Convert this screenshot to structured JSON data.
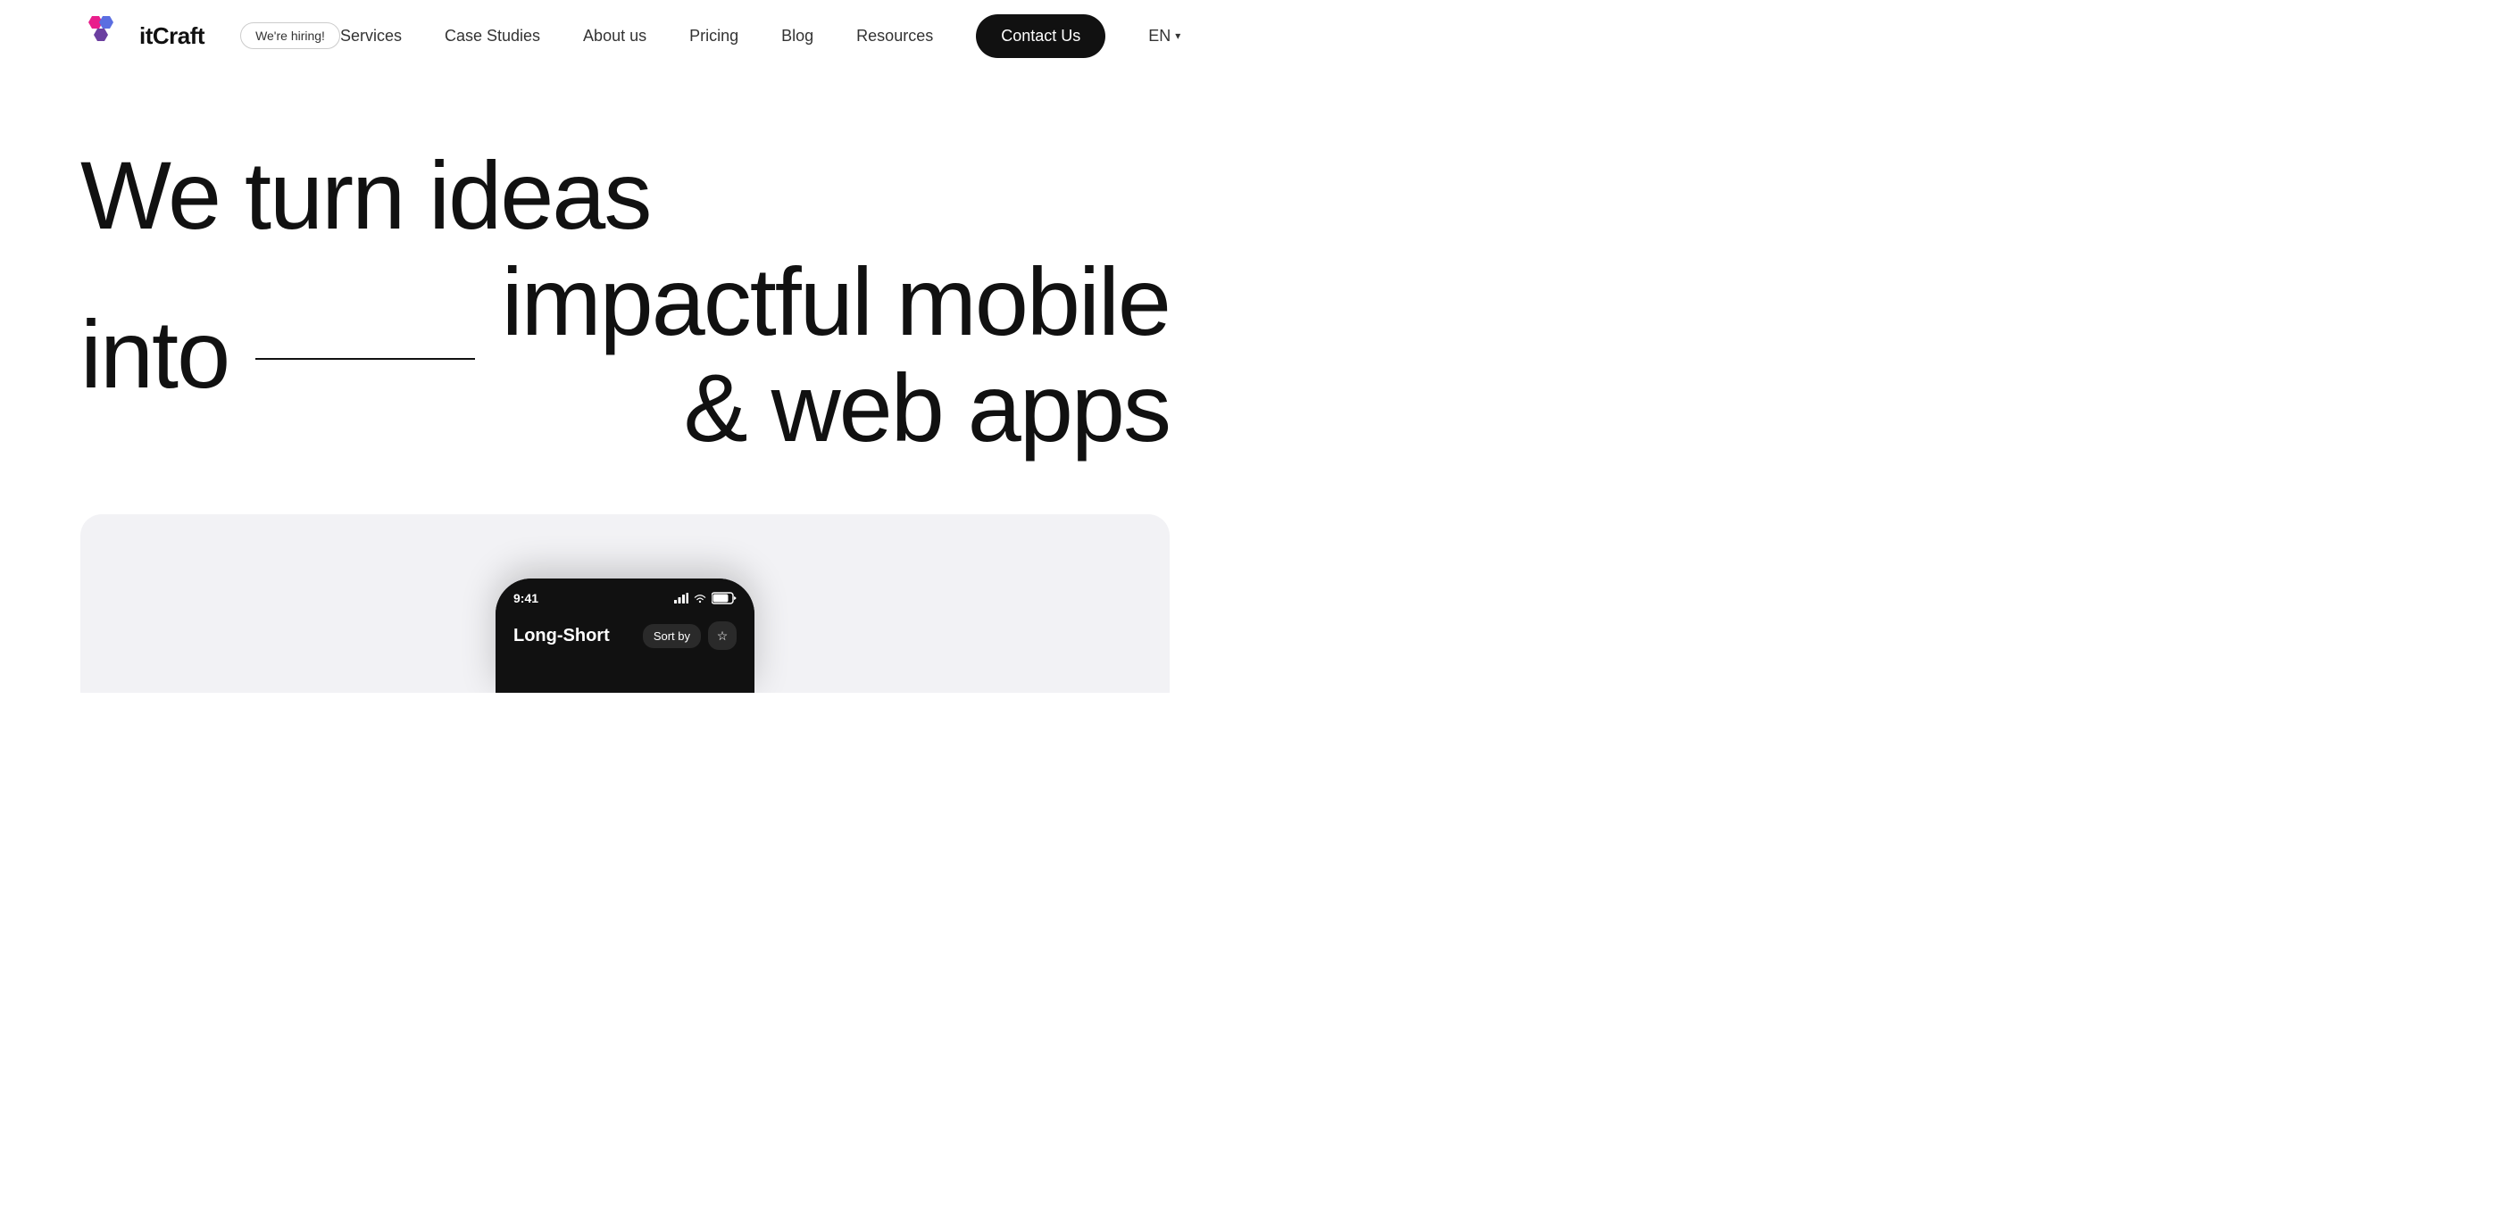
{
  "header": {
    "logo_text": "itCraft",
    "hiring_badge": "We're hiring!",
    "nav": {
      "services": "Services",
      "case_studies": "Case Studies",
      "about_us": "About us",
      "pricing": "Pricing",
      "blog": "Blog",
      "resources": "Resources",
      "contact_us": "Contact Us",
      "lang": "EN"
    }
  },
  "hero": {
    "line1": "We turn ideas",
    "line2_start": "into",
    "line2_end_1": "impactful mobile",
    "line2_end_2": "& web apps"
  },
  "phone": {
    "time": "9:41",
    "signal_icons": "▲ ◀ ■",
    "app_title": "Long-Short",
    "sort_by": "Sort by",
    "star": "☆"
  },
  "colors": {
    "background": "#ffffff",
    "text_primary": "#111111",
    "text_secondary": "#333333",
    "contact_btn_bg": "#111111",
    "contact_btn_text": "#ffffff",
    "mockup_bg": "#f2f2f5",
    "phone_bg": "#111111",
    "phone_text": "#ffffff"
  }
}
